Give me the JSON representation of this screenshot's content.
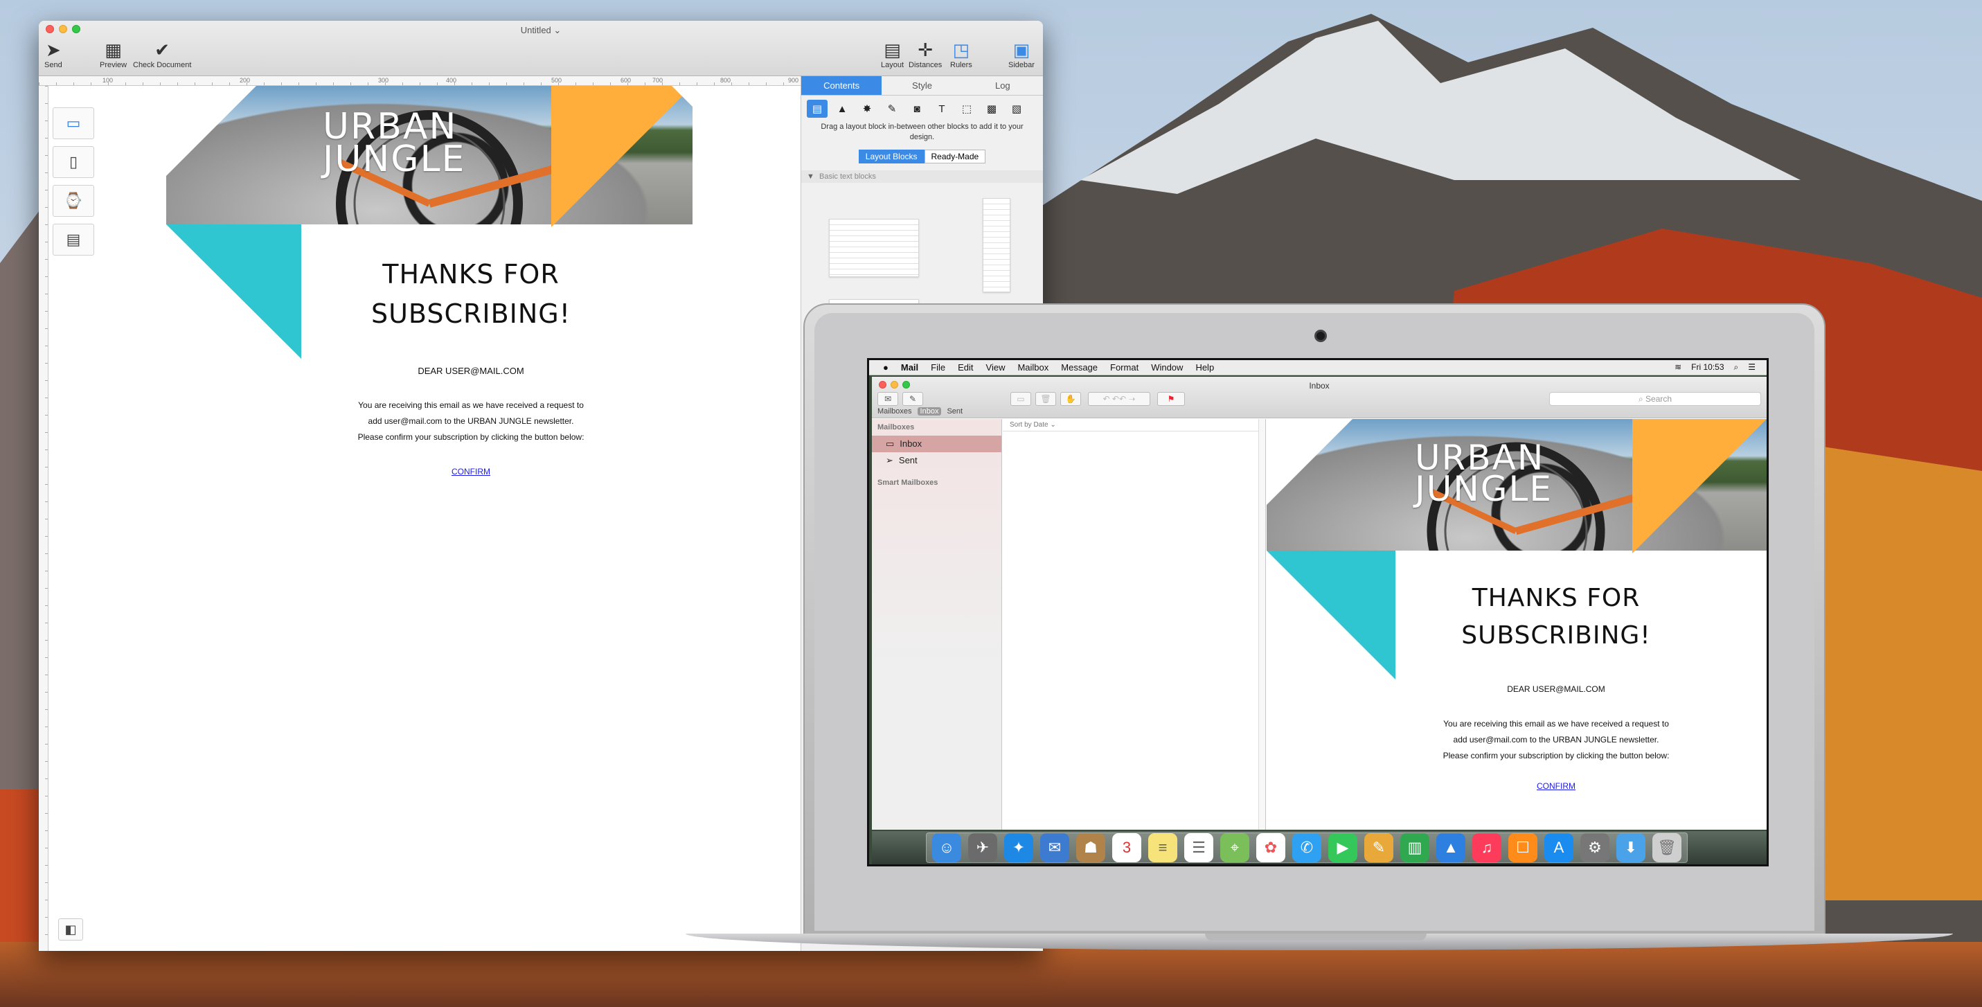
{
  "app": {
    "title": "Untitled ⌄",
    "toolbar": {
      "send": "Send",
      "preview": "Preview",
      "check": "Check Document",
      "layout": "Layout",
      "distances": "Distances",
      "rulers": "Rulers",
      "sidebar": "Sidebar"
    }
  },
  "ruler": {
    "ticks": [
      "100",
      "200",
      "300",
      "400",
      "500",
      "600",
      "700",
      "800",
      "900"
    ]
  },
  "email": {
    "logo_line1": "URBAN",
    "logo_line2": "JUNGLE",
    "title_line1": "THANKS FOR",
    "title_line2": "SUBSCRIBING!",
    "dear": "DEAR USER@MAIL.COM",
    "body_line1": "You are receiving this email as we have received a request to",
    "body_line2": "add user@mail.com to the URBAN JUNGLE newsletter.",
    "body_line3": "Please confirm your subscription by clicking the button below:",
    "confirm": "CONFIRM",
    "colors": {
      "orange": "#ffad3b",
      "cyan": "#2fc6d1"
    }
  },
  "sidebar": {
    "tabs": [
      "Contents",
      "Style",
      "Log"
    ],
    "hint": "Drag a layout block in-between other blocks to add it to your design.",
    "seg_layout": "Layout Blocks",
    "seg_ready": "Ready-Made",
    "group": "Basic text blocks"
  },
  "mac": {
    "menus": [
      "Mail",
      "File",
      "Edit",
      "View",
      "Mailbox",
      "Message",
      "Format",
      "Window",
      "Help"
    ],
    "clock": "Fri 10:53"
  },
  "mail": {
    "title": "Inbox",
    "search": "Search",
    "fav_mailboxes": "Mailboxes",
    "fav_inbox": "Inbox",
    "fav_sent": "Sent",
    "side_header": "Mailboxes",
    "inbox": "Inbox",
    "sent": "Sent",
    "smart": "Smart Mailboxes",
    "sort": "Sort by Date ⌄"
  }
}
